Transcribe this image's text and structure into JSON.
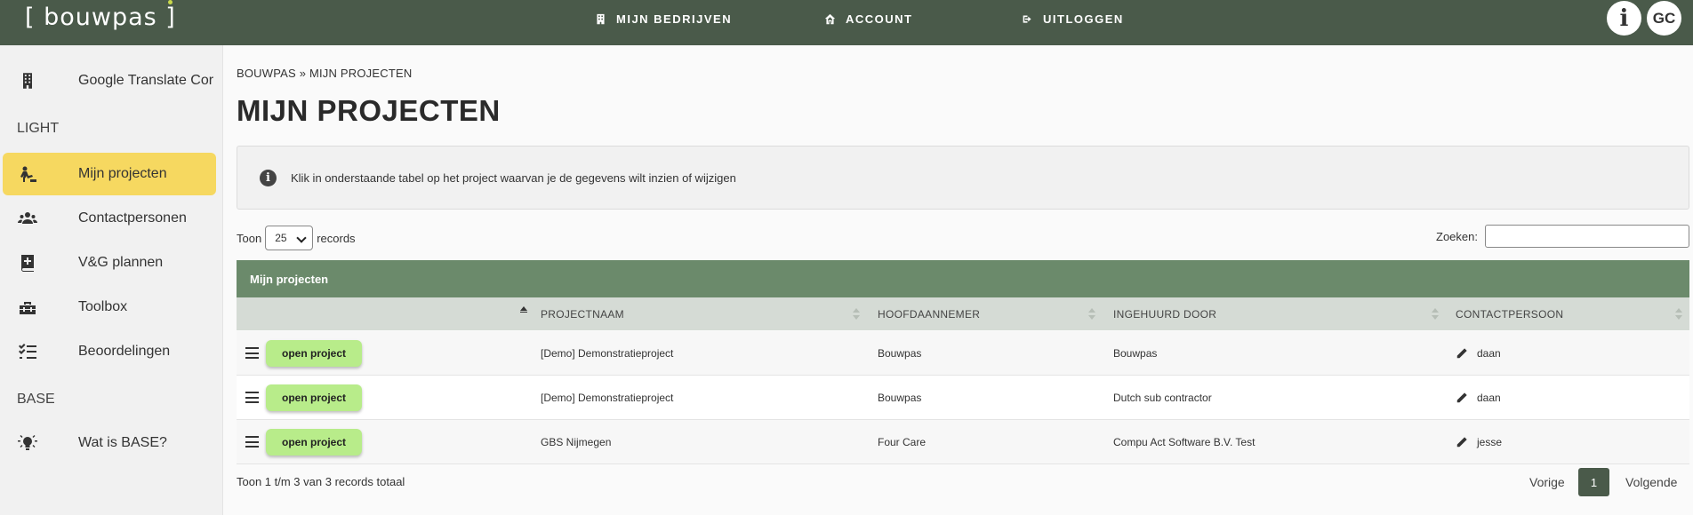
{
  "topbar": {
    "logo": "[ bouwpas ]",
    "nav": [
      {
        "label": "MIJN BEDRIJVEN",
        "icon": "building-icon"
      },
      {
        "label": "ACCOUNT",
        "icon": "home-icon"
      },
      {
        "label": "UITLOGGEN",
        "icon": "logout-icon"
      }
    ],
    "info_label": "i",
    "user_initials": "GC"
  },
  "sidebar": {
    "company": "Google Translate Cor",
    "section_light": "LIGHT",
    "items_light": [
      {
        "label": "Mijn projecten",
        "icon": "construction-worker-icon",
        "active": true
      },
      {
        "label": "Contactpersonen",
        "icon": "users-icon"
      },
      {
        "label": "V&G plannen",
        "icon": "medical-book-icon"
      },
      {
        "label": "Toolbox",
        "icon": "toolbox-icon"
      },
      {
        "label": "Beoordelingen",
        "icon": "checklist-icon"
      }
    ],
    "section_base": "BASE",
    "items_base": [
      {
        "label": "Wat is BASE?",
        "icon": "lightbulb-icon"
      }
    ]
  },
  "main": {
    "breadcrumb": "BOUWPAS » MIJN PROJECTEN",
    "title": "MIJN PROJECTEN",
    "info_text": "Klik in onderstaande tabel op het project waarvan je de gegevens wilt inzien of wijzigen",
    "toon_label": "Toon",
    "page_size": "25",
    "records_label": "records",
    "search_label": "Zoeken:",
    "search_value": "",
    "table": {
      "title": "Mijn projecten",
      "columns": [
        "PROJECTNAAM",
        "HOOFDAANNEMER",
        "INGEHUURD DOOR",
        "CONTACTPERSOON"
      ],
      "open_label": "open project",
      "rows": [
        {
          "projectnaam": "[Demo] Demonstratieproject",
          "hoofdaannemer": "Bouwpas",
          "ingehuurd_door": "Bouwpas",
          "contactpersoon": "daan"
        },
        {
          "projectnaam": "[Demo] Demonstratieproject",
          "hoofdaannemer": "Bouwpas",
          "ingehuurd_door": "Dutch sub contractor",
          "contactpersoon": "daan"
        },
        {
          "projectnaam": "GBS Nijmegen",
          "hoofdaannemer": "Four Care",
          "ingehuurd_door": "Compu Act Software B.V. Test",
          "contactpersoon": "jesse"
        }
      ]
    },
    "footer_info": "Toon 1 t/m 3 van 3 records totaal",
    "pagination": {
      "prev": "Vorige",
      "current": "1",
      "next": "Volgende"
    }
  },
  "colors": {
    "topbar": "#4a5a4a",
    "active_item": "#f6d860",
    "table_header": "#6b8a6b",
    "open_button": "#b8ec8a"
  }
}
